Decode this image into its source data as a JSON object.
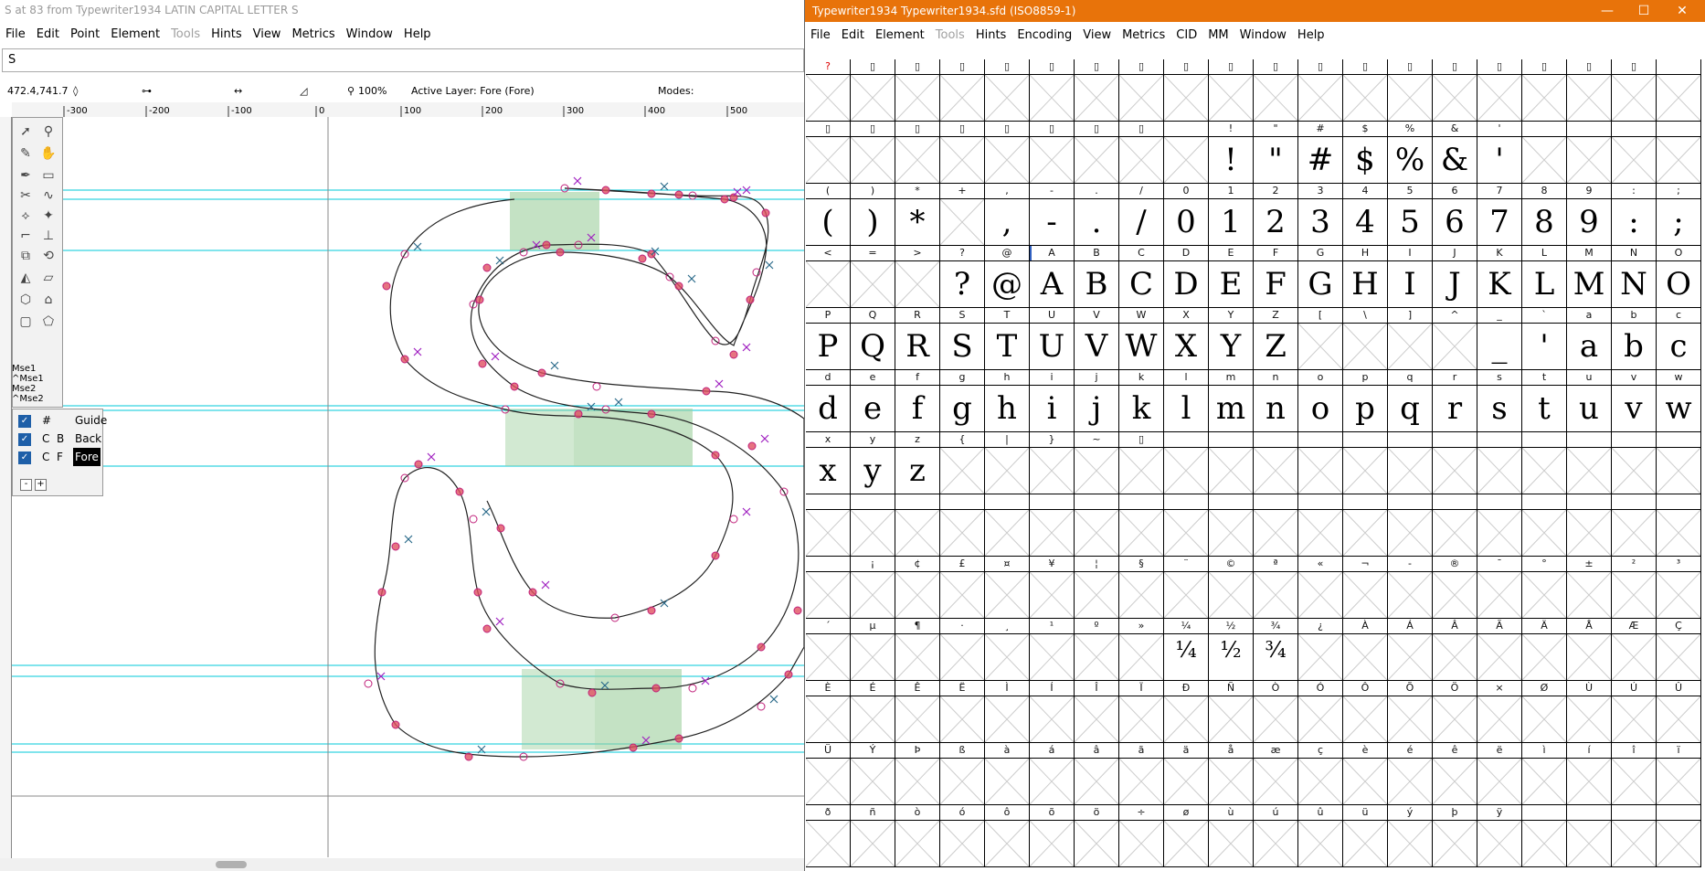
{
  "glyph_window": {
    "title": "S at 83 from Typewriter1934 LATIN CAPITAL LETTER S",
    "menu": [
      "File",
      "Edit",
      "Point",
      "Element",
      "Tools",
      "Hints",
      "View",
      "Metrics",
      "Window",
      "Help"
    ],
    "char_field": "S",
    "coords": "472.4,741.7",
    "zoom": "100%",
    "active_layer": "Active Layer: Fore (Fore)",
    "modes": "Modes:",
    "ruler_ticks": [
      "-300",
      "-200",
      "-100",
      "0",
      "100",
      "200",
      "300",
      "400",
      "500"
    ],
    "mse_labels": [
      "Mse1",
      "^Mse1",
      "Mse2",
      "^Mse2"
    ],
    "layers": [
      {
        "c1": "#",
        "c2": "",
        "name": "Guide",
        "active": false
      },
      {
        "c1": "C",
        "c2": "B",
        "name": "Back",
        "active": false
      },
      {
        "c1": "C",
        "c2": "F",
        "name": "Fore",
        "active": true
      }
    ],
    "layer_minus": "-",
    "layer_plus": "+"
  },
  "font_window": {
    "title": "Typewriter1934  Typewriter1934.sfd (ISO8859-1)",
    "menu": [
      "File",
      "Edit",
      "Element",
      "Tools",
      "Hints",
      "Encoding",
      "View",
      "Metrics",
      "CID",
      "MM",
      "Window",
      "Help"
    ],
    "rows": [
      {
        "labels": [
          "?",
          "▯",
          "▯",
          "▯",
          "▯",
          "▯",
          "▯",
          "▯",
          "▯",
          "▯",
          "▯",
          "▯",
          "▯",
          "▯",
          "▯",
          "▯",
          "▯",
          "▯",
          "▯"
        ],
        "glyphs": [
          "",
          "",
          "",
          "",
          "",
          "",
          "",
          "",
          "",
          "",
          "",
          "",
          "",
          "",
          "",
          "",
          "",
          "",
          ""
        ]
      },
      {
        "labels": [
          "▯",
          "▯",
          "▯",
          "▯",
          "▯",
          "▯",
          "▯",
          "▯",
          " ",
          "!",
          "\"",
          "#",
          "$",
          "%",
          "&",
          "'",
          " ",
          " ",
          " "
        ],
        "glyphs": [
          "",
          "",
          "",
          "",
          "",
          "",
          "",
          "",
          "",
          "!",
          "\"",
          "#",
          "$",
          "%",
          "&",
          "'",
          "",
          "",
          ""
        ]
      },
      {
        "labels": [
          "(",
          ")",
          "*",
          "+",
          ",",
          "-",
          ".",
          "/",
          "0",
          "1",
          "2",
          "3",
          "4",
          "5",
          "6",
          "7",
          "8",
          "9",
          ":",
          ";"
        ],
        "glyphs": [
          "(",
          ")",
          "*",
          "",
          ",",
          "-",
          ".",
          "/",
          "0",
          "1",
          "2",
          "3",
          "4",
          "5",
          "6",
          "7",
          "8",
          "9",
          ":",
          ";"
        ]
      },
      {
        "labels": [
          "<",
          "=",
          ">",
          "?",
          "@",
          "A",
          "B",
          "C",
          "D",
          "E",
          "F",
          "G",
          "H",
          "I",
          "J",
          "K",
          "L",
          "M",
          "N",
          "O"
        ],
        "glyphs": [
          "",
          "",
          "",
          "?",
          "@",
          "A",
          "B",
          "C",
          "D",
          "E",
          "F",
          "G",
          "H",
          "I",
          "J",
          "K",
          "L",
          "M",
          "N",
          "O"
        ]
      },
      {
        "labels": [
          "P",
          "Q",
          "R",
          "S",
          "T",
          "U",
          "V",
          "W",
          "X",
          "Y",
          "Z",
          "[",
          "\\",
          "]",
          "^",
          "_",
          "`",
          "a",
          "b",
          "c"
        ],
        "glyphs": [
          "P",
          "Q",
          "R",
          "S",
          "T",
          "U",
          "V",
          "W",
          "X",
          "Y",
          "Z",
          "",
          "",
          "",
          "",
          "_",
          "'",
          "a",
          "b",
          "c"
        ]
      },
      {
        "labels": [
          "d",
          "e",
          "f",
          "g",
          "h",
          "i",
          "j",
          "k",
          "l",
          "m",
          "n",
          "o",
          "p",
          "q",
          "r",
          "s",
          "t",
          "u",
          "v",
          "w"
        ],
        "glyphs": [
          "d",
          "e",
          "f",
          "g",
          "h",
          "i",
          "j",
          "k",
          "l",
          "m",
          "n",
          "o",
          "p",
          "q",
          "r",
          "s",
          "t",
          "u",
          "v",
          "w"
        ]
      },
      {
        "labels": [
          "x",
          "y",
          "z",
          "{",
          "|",
          "}",
          "~",
          "▯",
          "",
          "",
          "",
          "",
          "",
          "",
          "",
          "",
          "",
          "",
          "",
          ""
        ],
        "glyphs": [
          "x",
          "y",
          "z",
          "",
          "",
          "",
          "",
          "",
          "",
          "",
          "",
          "",
          "",
          "",
          "",
          "",
          "",
          "",
          "",
          ""
        ]
      },
      {
        "labels": [
          "",
          "",
          "",
          "",
          "",
          "",
          "",
          "",
          "",
          "",
          "",
          "",
          "",
          "",
          "",
          "",
          "",
          "",
          "",
          ""
        ],
        "glyphs": [
          "",
          "",
          "",
          "",
          "",
          "",
          "",
          "",
          "",
          "",
          "",
          "",
          "",
          "",
          "",
          "",
          "",
          "",
          "",
          ""
        ]
      },
      {
        "labels": [
          " ",
          "¡",
          "¢",
          "£",
          "¤",
          "¥",
          "¦",
          "§",
          "¨",
          "©",
          "ª",
          "«",
          "¬",
          "-",
          "®",
          "¯",
          "°",
          "±",
          "²",
          "³"
        ],
        "glyphs": [
          "",
          "",
          "",
          "",
          "",
          "",
          "",
          "",
          "",
          "",
          "",
          "",
          "",
          "",
          "",
          "",
          "",
          "",
          "",
          ""
        ]
      },
      {
        "labels": [
          "´",
          "µ",
          "¶",
          "·",
          "¸",
          "¹",
          "º",
          "»",
          "¼",
          "½",
          "¾",
          "¿",
          "À",
          "Á",
          "Â",
          "Ã",
          "Ä",
          "Å",
          "Æ",
          "Ç"
        ],
        "glyphs": [
          "",
          "",
          "",
          "",
          "",
          "",
          "",
          "",
          "¼",
          "½",
          "¾",
          "",
          "",
          "",
          "",
          "",
          "",
          "",
          "",
          ""
        ]
      },
      {
        "labels": [
          "È",
          "É",
          "Ê",
          "Ë",
          "Ì",
          "Í",
          "Î",
          "Ï",
          "Ð",
          "Ñ",
          "Ò",
          "Ó",
          "Ô",
          "Õ",
          "Ö",
          "×",
          "Ø",
          "Ù",
          "Ú",
          "Û"
        ],
        "glyphs": [
          "",
          "",
          "",
          "",
          "",
          "",
          "",
          "",
          "",
          "",
          "",
          "",
          "",
          "",
          "",
          "",
          "",
          "",
          "",
          ""
        ]
      },
      {
        "labels": [
          "Ü",
          "Ý",
          "Þ",
          "ß",
          "à",
          "á",
          "â",
          "ã",
          "ä",
          "å",
          "æ",
          "ç",
          "è",
          "é",
          "ê",
          "ë",
          "ì",
          "í",
          "î",
          "ï"
        ],
        "glyphs": [
          "",
          "",
          "",
          "",
          "",
          "",
          "",
          "",
          "",
          "",
          "",
          "",
          "",
          "",
          "",
          "",
          "",
          "",
          "",
          ""
        ]
      },
      {
        "labels": [
          "ð",
          "ñ",
          "ò",
          "ó",
          "ô",
          "õ",
          "ö",
          "÷",
          "ø",
          "ù",
          "ú",
          "û",
          "ü",
          "ý",
          "þ",
          "ÿ",
          "",
          "",
          "",
          ""
        ],
        "glyphs": [
          "",
          "",
          "",
          "",
          "",
          "",
          "",
          "",
          "",
          "",
          "",
          "",
          "",
          "",
          "",
          "",
          "",
          "",
          "",
          ""
        ]
      }
    ]
  },
  "colors": {
    "title_orange": "#e8730a",
    "guide_cyan": "#00c8d8",
    "point_pink": "#d0206e",
    "hint_green": "#a8d8a8",
    "check_blue": "#1e5fa8"
  }
}
